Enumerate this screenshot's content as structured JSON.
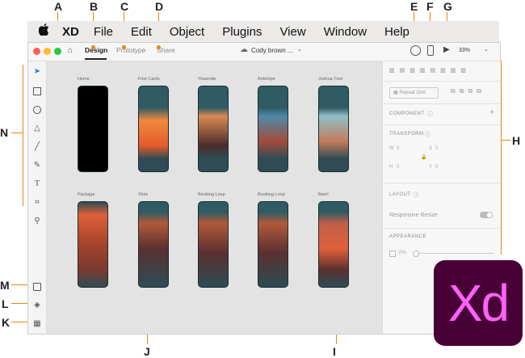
{
  "callouts": [
    "A",
    "B",
    "C",
    "D",
    "E",
    "F",
    "G",
    "H",
    "I",
    "J",
    "K",
    "L",
    "M",
    "N"
  ],
  "menubar": {
    "apple": "",
    "app_name": "XD",
    "items": [
      "File",
      "Edit",
      "Object",
      "Plugins",
      "View",
      "Window",
      "Help"
    ]
  },
  "window": {
    "tabs": [
      "Design",
      "Prototype",
      "Share"
    ],
    "doc_title": "Cody brown ...",
    "zoom": "33%"
  },
  "artboards": [
    {
      "label": "Home"
    },
    {
      "label": "First Cards"
    },
    {
      "label": "Yosemite"
    },
    {
      "label": "Antelope"
    },
    {
      "label": "Joshua Tree"
    },
    {
      "label": "Package"
    },
    {
      "label": "Slots"
    },
    {
      "label": "Booking Loop"
    },
    {
      "label": "Booking Loop"
    },
    {
      "label": "Bam!"
    }
  ],
  "panel": {
    "repeat_grid": "Repeat Grid",
    "component": "COMPONENT",
    "transform": "TRANSFORM",
    "w": "W",
    "w_val": "0",
    "x": "X",
    "x_val": "0",
    "h": "H",
    "h_val": "0",
    "y": "Y",
    "y_val": "0",
    "layout": "LAYOUT",
    "responsive_resize": "Responsive Resize",
    "appearance": "APPEARANCE",
    "opacity": "0%"
  },
  "logo": {
    "text": "Xd"
  },
  "colors": {
    "accent": "#e8870e",
    "xd_bg": "#470137",
    "xd_fg": "#ff61f6"
  }
}
